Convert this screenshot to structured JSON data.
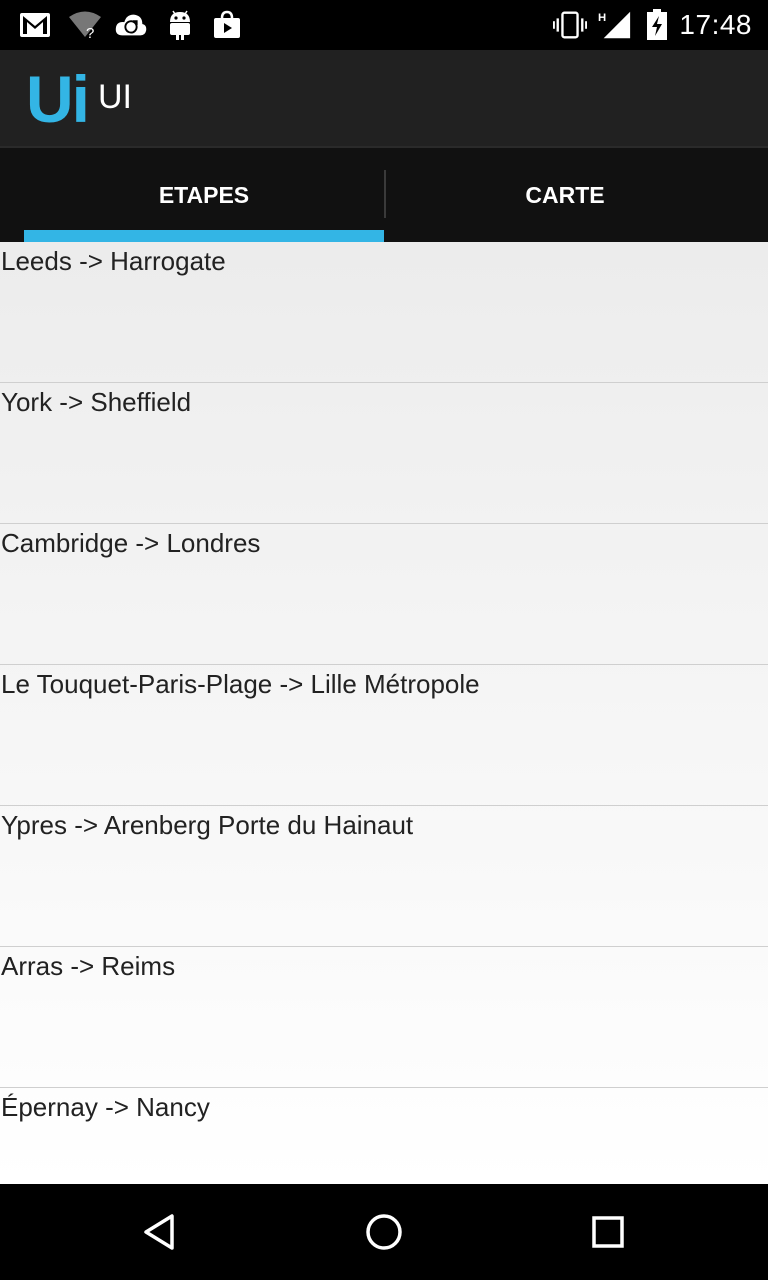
{
  "status_bar": {
    "time": "17:48",
    "icons": [
      "gmail-icon",
      "wifi-question-icon",
      "cloud-sync-icon",
      "android-icon",
      "bag-icon",
      "vibrate-icon",
      "signal-icon",
      "battery-charging-icon"
    ]
  },
  "app": {
    "logo": "Ui",
    "title": "UI",
    "accent": "#33b5e5"
  },
  "tabs": [
    {
      "label": "ETAPES",
      "selected": true
    },
    {
      "label": "CARTE",
      "selected": false
    }
  ],
  "stages": [
    {
      "label": "Leeds -> Harrogate"
    },
    {
      "label": "York -> Sheffield"
    },
    {
      "label": "Cambridge -> Londres"
    },
    {
      "label": "Le Touquet-Paris-Plage -> Lille Métropole"
    },
    {
      "label": "Ypres -> Arenberg Porte du Hainaut"
    },
    {
      "label": "Arras -> Reims"
    },
    {
      "label": "Épernay -> Nancy"
    }
  ],
  "nav": {
    "icons": [
      "back-icon",
      "home-icon",
      "recents-icon"
    ]
  }
}
